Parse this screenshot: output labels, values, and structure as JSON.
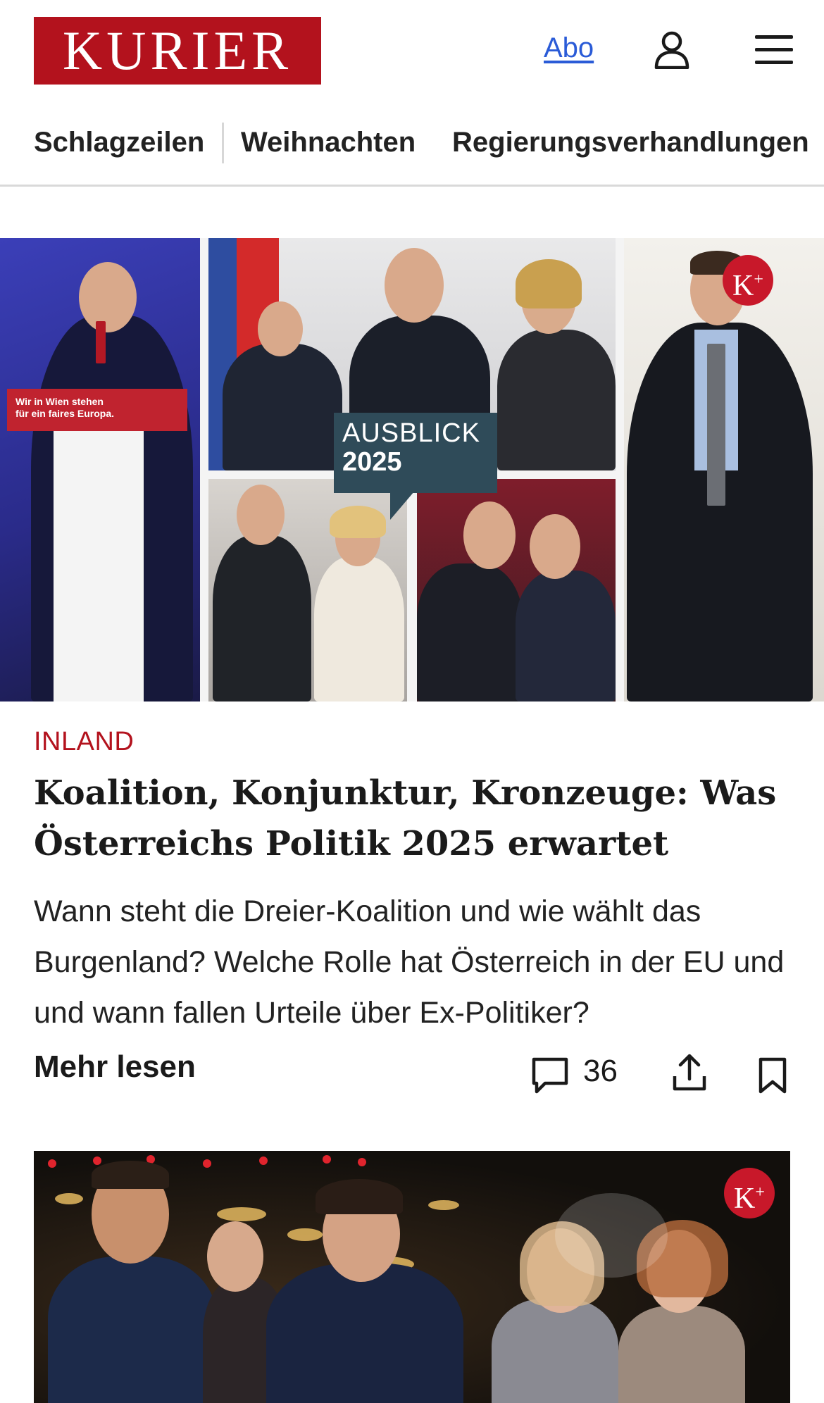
{
  "header": {
    "logo": "KURIER",
    "abo_label": "Abo",
    "icons": {
      "account": "user-icon",
      "menu": "hamburger-menu-icon"
    }
  },
  "nav": {
    "items": [
      "Schlagzeilen",
      "Weihnachten",
      "Regierungsverhandlungen"
    ]
  },
  "article1": {
    "image": {
      "podium_text_line1": "Wir in Wien stehen",
      "podium_text_line2": "für ein faires Europa.",
      "overlay_line1": "AUSBLICK",
      "overlay_line2": "2025",
      "badge": "K",
      "badge_plus": "+"
    },
    "category": "INLAND",
    "headline": "Koalition, Konjunktur, Kronzeuge: Was Österreichs Politik 2025 erwartet",
    "teaser": "Wann steht die Dreier-Koalition und wie wählt das Burgenland? Welche Rolle hat Österreich in der EU und und wann fallen Urteile über Ex-Politiker?",
    "more_label": "Mehr lesen",
    "comment_count": "36"
  },
  "article2": {
    "image": {
      "badge": "K",
      "badge_plus": "+"
    }
  },
  "colors": {
    "brand_red": "#b3121d",
    "link_blue": "#2a5bd7",
    "overlay_teal": "#2f4b59",
    "badge_red": "#c8182a"
  }
}
